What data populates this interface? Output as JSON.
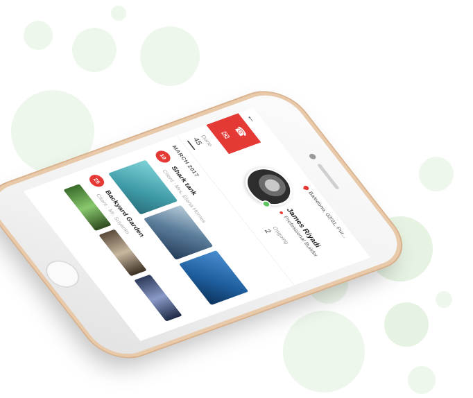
{
  "header": {
    "back_icon": "back-arrow-icon",
    "location": "Baledono, 02/01, Pur..."
  },
  "contact": {
    "phone_icon": "phone-icon",
    "mail_icon": "mail-icon",
    "accent_color": "#e53935"
  },
  "profile": {
    "name": "James Riyadi",
    "role": "Professional Builder",
    "status_color": "#5ec25e"
  },
  "stats": [
    {
      "label": "Done",
      "value": "45"
    },
    {
      "label": "Ongoing",
      "value": "2"
    }
  ],
  "timeline": {
    "month": "MARCH 2017",
    "entries": [
      {
        "day": "10",
        "title": "Shark tank",
        "client": "Client : Mrs. Elena Homes"
      },
      {
        "day": "25",
        "title": "Backyard Garden",
        "client": "Client : Mr. Suyanto"
      }
    ]
  }
}
